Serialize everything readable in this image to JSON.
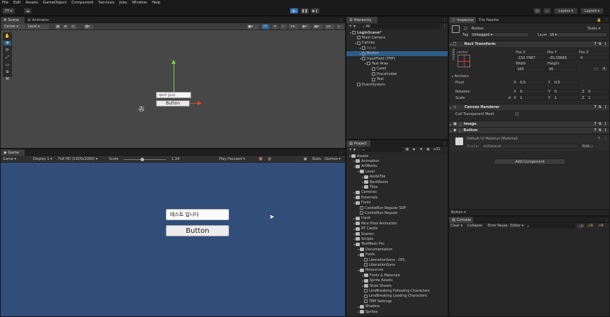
{
  "menu": [
    "File",
    "Edit",
    "Assets",
    "GameObject",
    "Component",
    "Services",
    "Jobs",
    "Window",
    "Help"
  ],
  "toolbar": {
    "account": "YY",
    "layers": "Layers",
    "layout": "Layout"
  },
  "scene": {
    "tabs": [
      "Scene",
      "Animator"
    ],
    "pivot": "Center",
    "space": "Local",
    "mode2d": "2D",
    "input_text": "테스트 입니다",
    "button_text": "Button"
  },
  "game": {
    "tab": "Game",
    "mode": "Game",
    "display": "Display 1",
    "resolution": "Full HD (1920x1080)",
    "scale_label": "Scale",
    "scale_value": "1.34",
    "play_focused": "Play Focused",
    "stats": "Stats",
    "gizmos": "Gizmos",
    "input_text": "테스트 입니다",
    "button_text": "Button"
  },
  "hierarchy": {
    "tab": "Hierarchy",
    "search": "All",
    "items": [
      {
        "label": "LoginScene*",
        "depth": 0,
        "arrow": "▾",
        "bold": true
      },
      {
        "label": "Main Camera",
        "depth": 1,
        "arrow": ""
      },
      {
        "label": "Canvas",
        "depth": 1,
        "arrow": "▾"
      },
      {
        "label": "Panel",
        "depth": 2,
        "arrow": "▸",
        "dim": true
      },
      {
        "label": "Button",
        "depth": 2,
        "arrow": "▸",
        "selected": true
      },
      {
        "label": "InputField (TMP)",
        "depth": 2,
        "arrow": "▾"
      },
      {
        "label": "Text Area",
        "depth": 3,
        "arrow": "▾"
      },
      {
        "label": "Caret",
        "depth": 4,
        "arrow": ""
      },
      {
        "label": "Placeholder",
        "depth": 4,
        "arrow": ""
      },
      {
        "label": "Text",
        "depth": 4,
        "arrow": ""
      },
      {
        "label": "EventSystem",
        "depth": 1,
        "arrow": ""
      }
    ]
  },
  "project": {
    "tab": "Project",
    "count": "31",
    "items": [
      {
        "label": "Assets",
        "depth": 0,
        "arrow": "▾"
      },
      {
        "label": "Animation",
        "depth": 1,
        "arrow": "▸"
      },
      {
        "label": "ArtWorks",
        "depth": 1,
        "arrow": "▾"
      },
      {
        "label": "Level",
        "depth": 2,
        "arrow": "▾"
      },
      {
        "label": "AsideTile",
        "depth": 3,
        "arrow": "▸"
      },
      {
        "label": "BackRoom",
        "depth": 3,
        "arrow": "▸"
      },
      {
        "label": "Tiles",
        "depth": 3,
        "arrow": "▸"
      },
      {
        "label": "Cameras",
        "depth": 1,
        "arrow": "▸"
      },
      {
        "label": "Externals",
        "depth": 1,
        "arrow": "▸"
      },
      {
        "label": "Fonts",
        "depth": 1,
        "arrow": "▾"
      },
      {
        "label": "CookieRun Regular SDF",
        "depth": 2,
        "arrow": "",
        "file": true
      },
      {
        "label": "CookieRun Regular",
        "depth": 2,
        "arrow": "",
        "file": true
      },
      {
        "label": "Input",
        "depth": 1,
        "arrow": "▸"
      },
      {
        "label": "Nice Pixel Animation",
        "depth": 1,
        "arrow": "▸"
      },
      {
        "label": "RT Castle",
        "depth": 1,
        "arrow": "▸"
      },
      {
        "label": "Scenes",
        "depth": 1,
        "arrow": "▸"
      },
      {
        "label": "Scripts",
        "depth": 1,
        "arrow": "▸"
      },
      {
        "label": "TextMesh Pro",
        "depth": 1,
        "arrow": "▾"
      },
      {
        "label": "Documentation",
        "depth": 2,
        "arrow": "▸"
      },
      {
        "label": "Fonts",
        "depth": 2,
        "arrow": "▾"
      },
      {
        "label": "LiberationSans - OFL",
        "depth": 3,
        "arrow": "",
        "file": true
      },
      {
        "label": "LiberationSans",
        "depth": 3,
        "arrow": "",
        "file": true
      },
      {
        "label": "Resources",
        "depth": 2,
        "arrow": "▾"
      },
      {
        "label": "Fonts & Materials",
        "depth": 3,
        "arrow": "▸"
      },
      {
        "label": "Sprite Assets",
        "depth": 3,
        "arrow": "▸"
      },
      {
        "label": "Style Sheets",
        "depth": 3,
        "arrow": "▸"
      },
      {
        "label": "LineBreaking Following Characters",
        "depth": 3,
        "arrow": "",
        "file": true
      },
      {
        "label": "LineBreaking Leading Characters",
        "depth": 3,
        "arrow": "",
        "file": true
      },
      {
        "label": "TMP Settings",
        "depth": 3,
        "arrow": "",
        "file": true
      },
      {
        "label": "Shaders",
        "depth": 2,
        "arrow": "▸"
      },
      {
        "label": "Sprites",
        "depth": 2,
        "arrow": "▸"
      }
    ]
  },
  "inspector": {
    "tabs": [
      "Inspector",
      "Tile Palette"
    ],
    "object_name": "Button",
    "static_label": "Static",
    "tag_label": "Tag",
    "tag_value": "Untagged",
    "layer_label": "Layer",
    "layer_value": "UI",
    "rect_transform": "Rect Transform",
    "anchor_preset": "center",
    "middle_label": "middle",
    "pos_x_label": "Pos X",
    "pos_y_label": "Pos Y",
    "pos_z_label": "Pos Z",
    "pos_x": "-153.7067",
    "pos_y": "-35.03665",
    "pos_z": "0",
    "width_label": "Width",
    "height_label": "Height",
    "width": "160",
    "height": "30",
    "raw_button": "R",
    "anchors_label": "Anchors",
    "pivot_label": "Pivot",
    "pivot_x": "0.5",
    "pivot_y": "0.5",
    "rotation_label": "Rotation",
    "rot_x": "0",
    "rot_y": "0",
    "rot_z": "0",
    "scale_label": "Scale",
    "scale_x": "1",
    "scale_y": "1",
    "scale_z": "1",
    "canvas_renderer": "Canvas Renderer",
    "cull_label": "Cull Transparent Mesh",
    "image_label": "Image",
    "button_label": "Button",
    "material_title": "Default UI Material (Material)",
    "shader_label": "Shader",
    "shader_value": "UI/Default",
    "edit_button": "Edit...",
    "add_component": "Add Component",
    "footer_label": "Button ▾"
  },
  "console": {
    "tab": "Console",
    "clear": "Clear",
    "collapse": "Collapse",
    "error_pause": "Error Pause",
    "editor": "Editor",
    "counts": [
      "0",
      "0",
      "0"
    ]
  },
  "colors": {
    "game_bg": "#314d79",
    "selected": "#2c5d87",
    "play_blue": "#3a79bb",
    "accent_green": "#6fdc3a",
    "accent_red": "#e0442a"
  }
}
